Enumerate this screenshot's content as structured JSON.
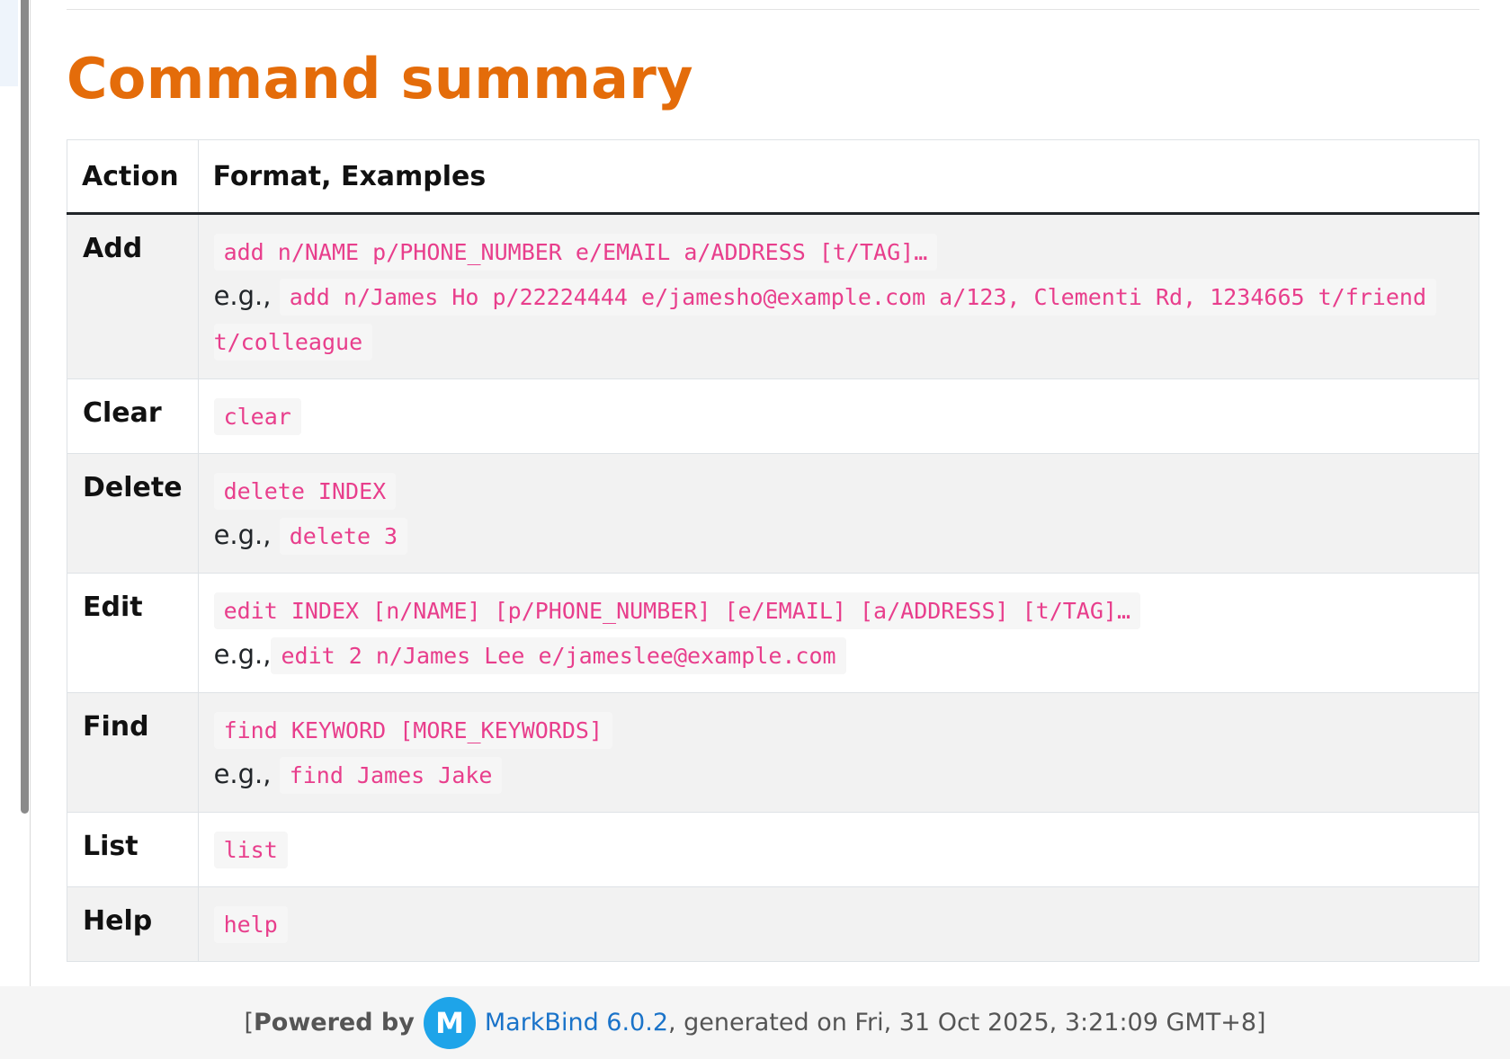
{
  "page": {
    "title": "Command summary"
  },
  "table": {
    "headers": {
      "action": "Action",
      "format": "Format, Examples"
    },
    "eg_label": "e.g.,",
    "rows": [
      {
        "action": "Add",
        "format": "add n/NAME p/PHONE_NUMBER e/EMAIL a/ADDRESS [t/TAG]…",
        "example_part1": "add n/James Ho p/22224444 e/jamesho@example.com a/123, Clementi Rd, 1234665 t/friend",
        "example_part2": "t/colleague"
      },
      {
        "action": "Clear",
        "format": "clear"
      },
      {
        "action": "Delete",
        "format": "delete INDEX",
        "example": "delete 3"
      },
      {
        "action": "Edit",
        "format": "edit INDEX [n/NAME] [p/PHONE_NUMBER] [e/EMAIL] [a/ADDRESS] [t/TAG]…",
        "example": "edit 2 n/James Lee e/jameslee@example.com"
      },
      {
        "action": "Find",
        "format": "find KEYWORD [MORE_KEYWORDS]",
        "example": "find James Jake"
      },
      {
        "action": "List",
        "format": "list"
      },
      {
        "action": "Help",
        "format": "help"
      }
    ]
  },
  "footer": {
    "open_bracket": "[",
    "powered_by": "Powered by",
    "logo_letter": "M",
    "link_text": "MarkBind 6.0.2",
    "generated_text": ", generated on Fri, 31 Oct 2025, 3:21:09 GMT+8]"
  },
  "colors": {
    "title": "#e46c0a",
    "code_text": "#e83e8c",
    "code_bg": "#f6f6f6",
    "stripe_bg": "#f2f2f2",
    "link": "#1a73c9",
    "logo_bg": "#1ea4e9"
  },
  "icons": {
    "footer_logo": "markbind-logo-icon"
  }
}
